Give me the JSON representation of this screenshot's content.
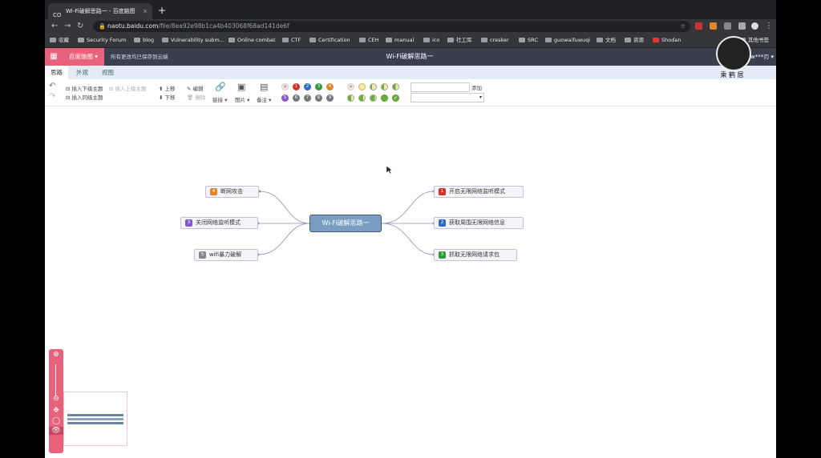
{
  "browser": {
    "tab_title": "Wi-Fi破解思路一 - 百度脑图",
    "tab_favicon": "CO",
    "new_tab": "+",
    "url_host": "naotu.baidu.com",
    "url_path": "/file/8ea92e98b1ca4b403068f68ad141de6f",
    "bookmarks": [
      "収藏",
      "Security Forum",
      "blog",
      "Vulnerability subm...",
      "Online combat",
      "CTF",
      "Certification",
      "CEH",
      "manual",
      "ico",
      "社工库",
      "cresker",
      "SRC",
      "guowaifuwuqi",
      "文档",
      "资源",
      "Shodan",
      "其他书签"
    ]
  },
  "app": {
    "grid_icon": "grid-icon",
    "brand": "百度脑图 ▾",
    "save_status": "所有更改均已保存到云端",
    "doc_title": "Wi-Fi破解思路一",
    "user": "w***刃 ▾"
  },
  "tabs": [
    "思路",
    "外观",
    "视图"
  ],
  "toolbar": {
    "insert_child": "插入下级主题",
    "insert_parent": "插入上级主题",
    "insert_sibling": "插入同级主题",
    "move_up": "上移",
    "move_down": "下移",
    "edit": "编辑",
    "delete": "删除",
    "link": "链接",
    "image": "图片",
    "note": "备注",
    "tag_add": "添加",
    "priority_row1": [
      "✕",
      "1",
      "2",
      "3",
      "4"
    ],
    "priority_row2": [
      "5",
      "6",
      "7",
      "8",
      "9"
    ],
    "priority_colors": [
      "#f0f0f0",
      "#d9302a",
      "#2e6bc6",
      "#2f9a3a",
      "#e2862a",
      "#8957c9",
      "#777777",
      "#777777",
      "#777777",
      "#777777"
    ]
  },
  "mindmap": {
    "root": "Wi-Fi破解思路一",
    "left": [
      {
        "badge": "4",
        "color": "#e2862a",
        "label": "断网攻击"
      },
      {
        "badge": "3",
        "color": "#8957c9",
        "label": "关闭网络监听模式"
      },
      {
        "badge": "5",
        "color": "#888888",
        "label": "wifi暴力破解"
      }
    ],
    "right": [
      {
        "badge": "1",
        "color": "#d9302a",
        "label": "开启无限网络监听模式"
      },
      {
        "badge": "2",
        "color": "#2e6bc6",
        "label": "获取周围无限网络信息"
      },
      {
        "badge": "3",
        "color": "#2f9a3a",
        "label": "抓取无限网络请求包"
      }
    ]
  },
  "overlay": {
    "watermark": "乘 鹤 居"
  },
  "colors": {
    "accent": "#e9627c",
    "header": "#393f4f",
    "node_border": "#c7bfd9",
    "link": "#8b8fb8"
  }
}
